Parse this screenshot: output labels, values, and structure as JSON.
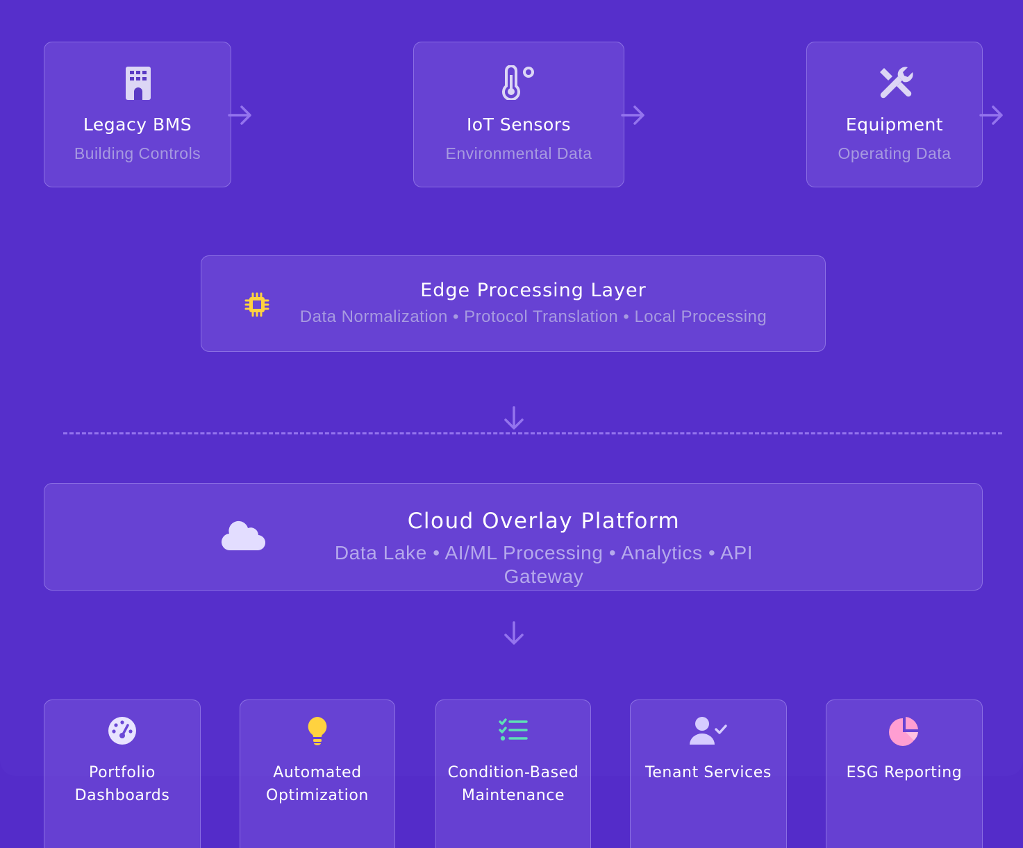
{
  "sources": [
    {
      "title": "Legacy BMS",
      "subtitle": "Building Controls",
      "icon": "building-icon"
    },
    {
      "title": "IoT Sensors",
      "subtitle": "Environmental Data",
      "icon": "thermometer-icon"
    },
    {
      "title": "Equipment",
      "subtitle": "Operating Data",
      "icon": "tools-icon"
    }
  ],
  "edge": {
    "title": "Edge Processing Layer",
    "subtitle": "Data Normalization • Protocol Translation • Local Processing",
    "icon": "chip-icon"
  },
  "cloud": {
    "title": "Cloud Overlay Platform",
    "subtitle_line1": "Data Lake • AI/ML Processing • Analytics • API",
    "subtitle_line2": "Gateway",
    "icon": "cloud-icon"
  },
  "outputs": [
    {
      "title": "Portfolio Dashboards",
      "icon": "gauge-icon",
      "color": "#e8e4ff"
    },
    {
      "title": "Automated Optimization",
      "icon": "lightbulb-icon",
      "color": "#ffd23f"
    },
    {
      "title": "Condition-Based Maintenance",
      "icon": "checklist-icon",
      "color": "#5ee0b5"
    },
    {
      "title": "Tenant Services",
      "icon": "user-check-icon",
      "color": "#d6ccff"
    },
    {
      "title": "ESG Reporting",
      "icon": "pie-chart-icon",
      "color": "#ff9ed2"
    }
  ],
  "colors": {
    "background": "#542cc9",
    "card": "#6a48d6",
    "accent_line": "#9474ee",
    "subtext": "#a79ae0"
  }
}
